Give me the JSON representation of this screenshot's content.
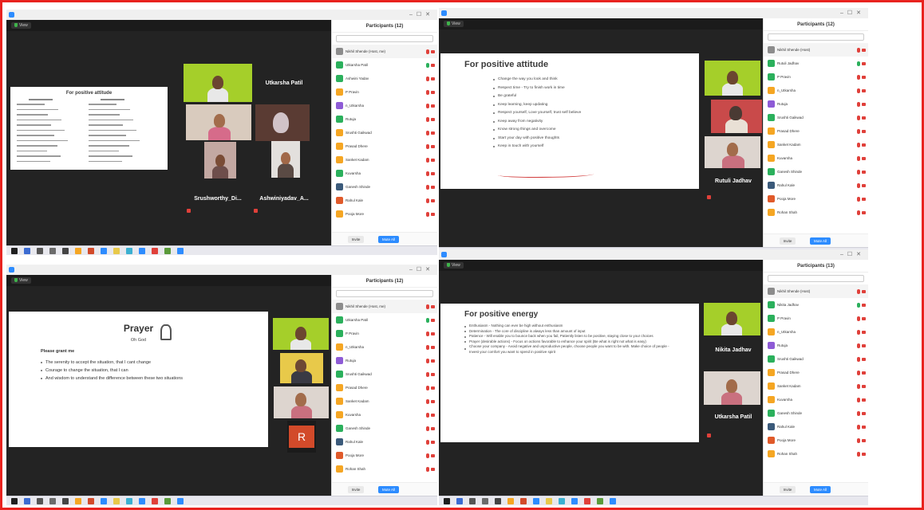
{
  "colors": {
    "border": "#e8231f",
    "zoom_blue": "#2d8cff",
    "meeting_bg": "#232323",
    "green_screen": "#a5cf2a",
    "mute_red": "#e0403a"
  },
  "q1": {
    "slide_title": "For positive attitude",
    "names": {
      "top_right": "Utkarsha Patil",
      "bottom_left": "Srushworthy_Di...",
      "bottom_right": "Ashwiniyadav_A..."
    },
    "panel_title": "Participants (12)"
  },
  "q2": {
    "slide_title": "For positive attitude",
    "bullets": [
      "Change the way you look and think",
      "Respect time - Try to finish work in time",
      "Be grateful",
      "Keep learning, keep updating",
      "Respect yourself, Love yourself, trust self believe",
      "Keep away from negativity",
      "Know strong things and overcome",
      "Start your day with positive thoughts",
      "Keep in touch with yourself"
    ],
    "tile_name": "Rutuli Jadhav",
    "panel_title": "Participants (12)"
  },
  "q3": {
    "slide_title": "Prayer",
    "subtitle": "Oh God",
    "intro": "Please grant me",
    "bullets": [
      "The serenity to accept the situation, that I cant change",
      "Courage to change the situation, that I can",
      "And wisdom to understand the difference between these two situations"
    ],
    "avatar_letter": "R",
    "panel_title": "Participants (12)"
  },
  "q4": {
    "slide_title": "For positive energy",
    "bullets": [
      "Enthusiasm - Nothing can ever be high without enthusiasm",
      "Determination - The core of discipline is always less than amount of input",
      "Patience - Will enable you to bounce back when you fail, Patiently listen to be positive, staying close to your choices",
      "Prayer (desirable actions) - Focus on actions favorable to enhance your spirit (Be what is right not what is easy)",
      "Choose your company - Avoid negative and unproductive people, choose people you want to be with. Make choice of people - Invest your comfort you want to spend in positive spirit"
    ],
    "tile_names": [
      "Nikita Jadhav",
      "Utkarsha Patil"
    ],
    "panel_title": "Participants (13)"
  },
  "participants": {
    "q1": [
      "Nikhil Shende (Host, me)",
      "Utkarsha Patil",
      "Ashwini Yadav",
      "P Pravin",
      "n_Utkarsha",
      "Rutuja",
      "Srushti Gaikwad",
      "Prasad Dhere",
      "Sanket Kadam",
      "Kuvarsha",
      "Ganesh Shinde",
      "Rahul Kale",
      "Pooja More"
    ],
    "q2": [
      "Nikhil Shende (Host)",
      "Rutuli Jadhav",
      "P Pravin",
      "n_Utkarsha",
      "Rutuja",
      "Srushti Gaikwad",
      "Prasad Dhere",
      "Sanket Kadam",
      "Kuvarsha",
      "Ganesh Shinde",
      "Rahul Kale",
      "Pooja More",
      "Rohan Shah"
    ],
    "q3": [
      "Nikhil Shende (Host, me)",
      "Utkarsha Patil",
      "P Pravin",
      "n_Utkarsha",
      "Rutuja",
      "Srushti Gaikwad",
      "Prasad Dhere",
      "Sanket Kadam",
      "Kuvarsha",
      "Ganesh Shinde",
      "Rahul Kale",
      "Pooja More",
      "Rohan Shah"
    ],
    "q4": [
      "Nikhil Shende (Host)",
      "Nikita Jadhav",
      "P Pravin",
      "n_Utkarsha",
      "Rutuja",
      "Srushti Gaikwad",
      "Prasad Dhere",
      "Sanket Kadam",
      "Kuvarsha",
      "Ganesh Shinde",
      "Rahul Kale",
      "Pooja More",
      "Rohan Shah"
    ]
  }
}
